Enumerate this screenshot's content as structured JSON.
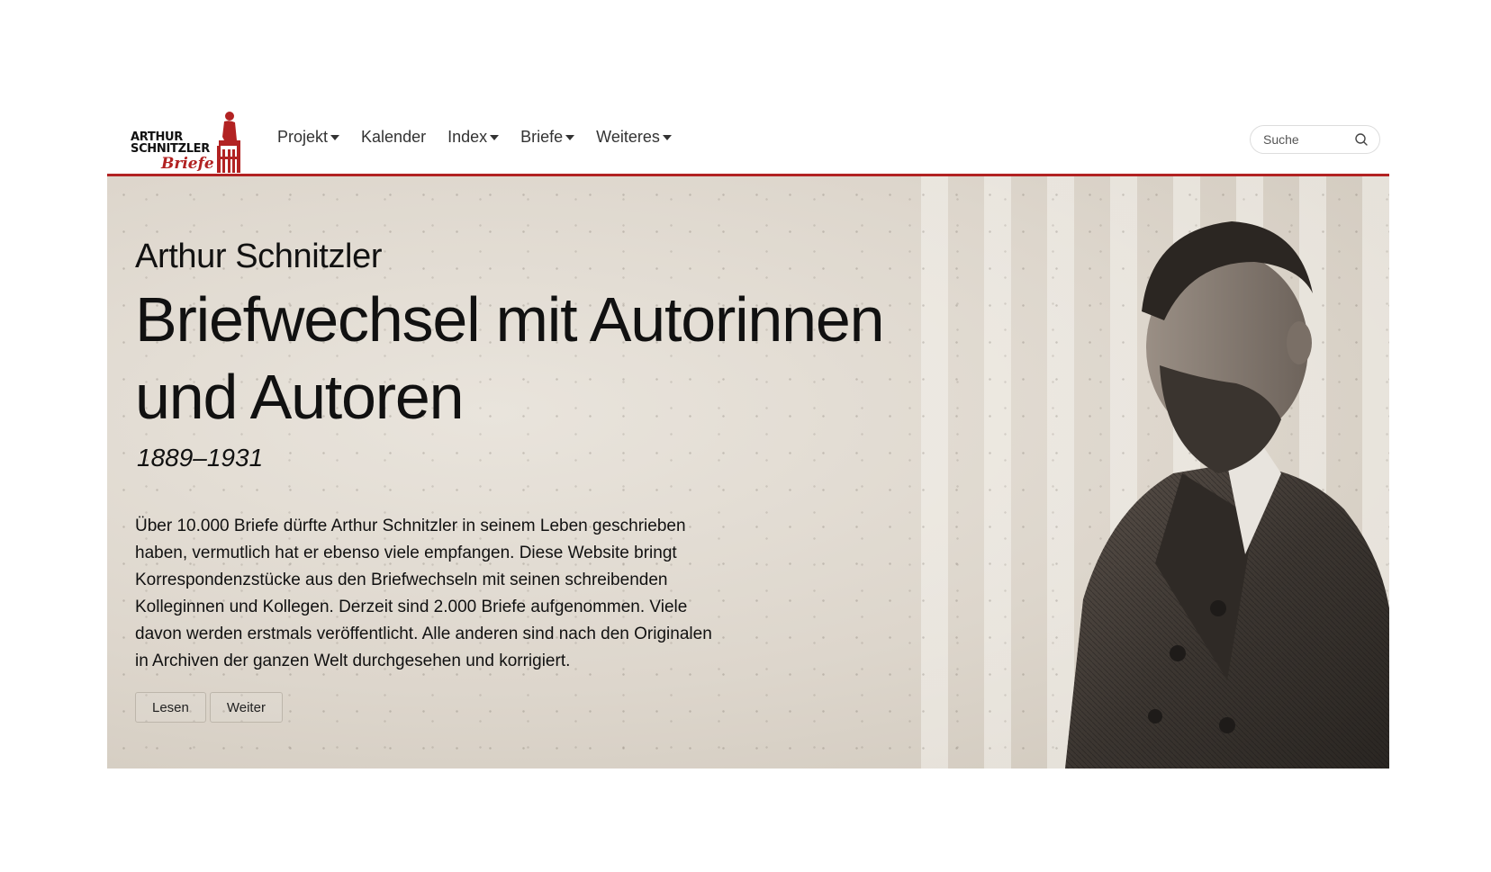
{
  "brand": {
    "line1": "ARTHUR",
    "line2": "SCHNITZLER",
    "line3": "Briefe",
    "accent_color": "#b22222"
  },
  "nav": {
    "items": [
      {
        "label": "Projekt",
        "dropdown": true
      },
      {
        "label": "Kalender",
        "dropdown": false
      },
      {
        "label": "Index",
        "dropdown": true
      },
      {
        "label": "Briefe",
        "dropdown": true
      },
      {
        "label": "Weiteres",
        "dropdown": true
      }
    ]
  },
  "search": {
    "placeholder": "Suche",
    "icon": "search-icon"
  },
  "hero": {
    "overline": "Arthur Schnitzler",
    "title_line1": "Briefwechsel mit Autorinnen",
    "title_line2": "und Autoren",
    "years": "1889–1931",
    "text": "Über 10.000 Briefe dürfte Arthur Schnitzler in seinem Leben geschrieben haben, vermutlich hat er ebenso viele empfangen. Diese Website bringt Korrespondenzstücke aus den Briefwechseln mit seinen schreibenden Kolleginnen und Kollegen. Derzeit sind 2.000 Briefe aufgenommen. Viele davon werden erstmals veröffentlicht. Alle anderen sind nach den Originalen in Archiven der ganzen Welt durchgesehen und korrigiert.",
    "buttons": {
      "read": "Lesen",
      "more": "Weiter"
    }
  }
}
